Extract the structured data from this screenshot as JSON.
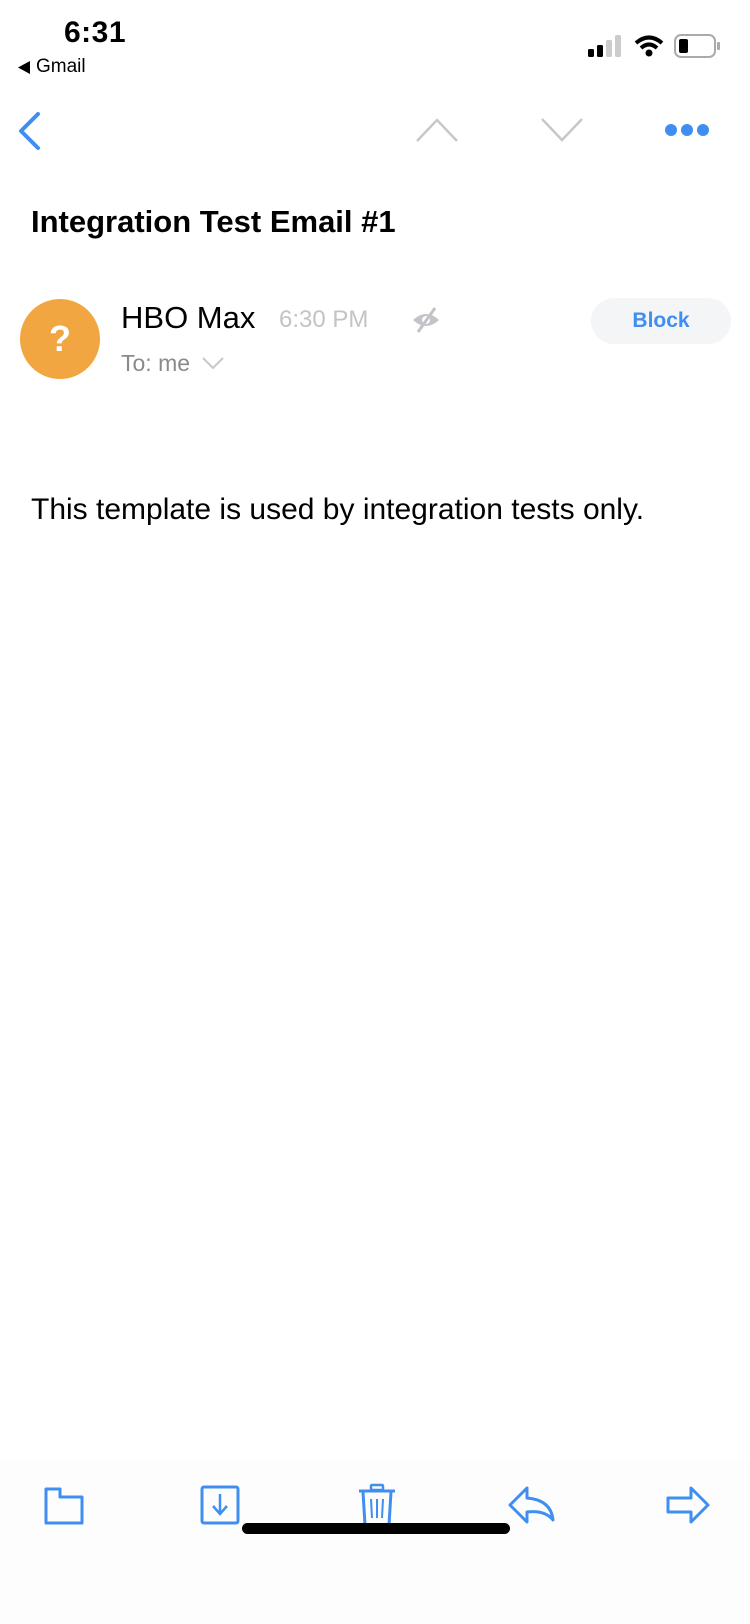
{
  "status_bar": {
    "time": "6:31",
    "back_app": "Gmail"
  },
  "nav": {
    "back": "back-icon",
    "prev": "chevron-up-icon",
    "next": "chevron-down-icon",
    "more": "more-icon"
  },
  "email": {
    "subject": "Integration Test Email #1",
    "avatar_letter": "?",
    "sender": "HBO Max",
    "time": "6:30 PM",
    "to": "To: me",
    "block_label": "Block",
    "body": "This template is used by integration tests only."
  },
  "colors": {
    "accent": "#3f8ef0",
    "avatar": "#f2a641"
  },
  "toolbar": [
    "folder-icon",
    "archive-icon",
    "trash-icon",
    "reply-icon",
    "forward-icon"
  ]
}
